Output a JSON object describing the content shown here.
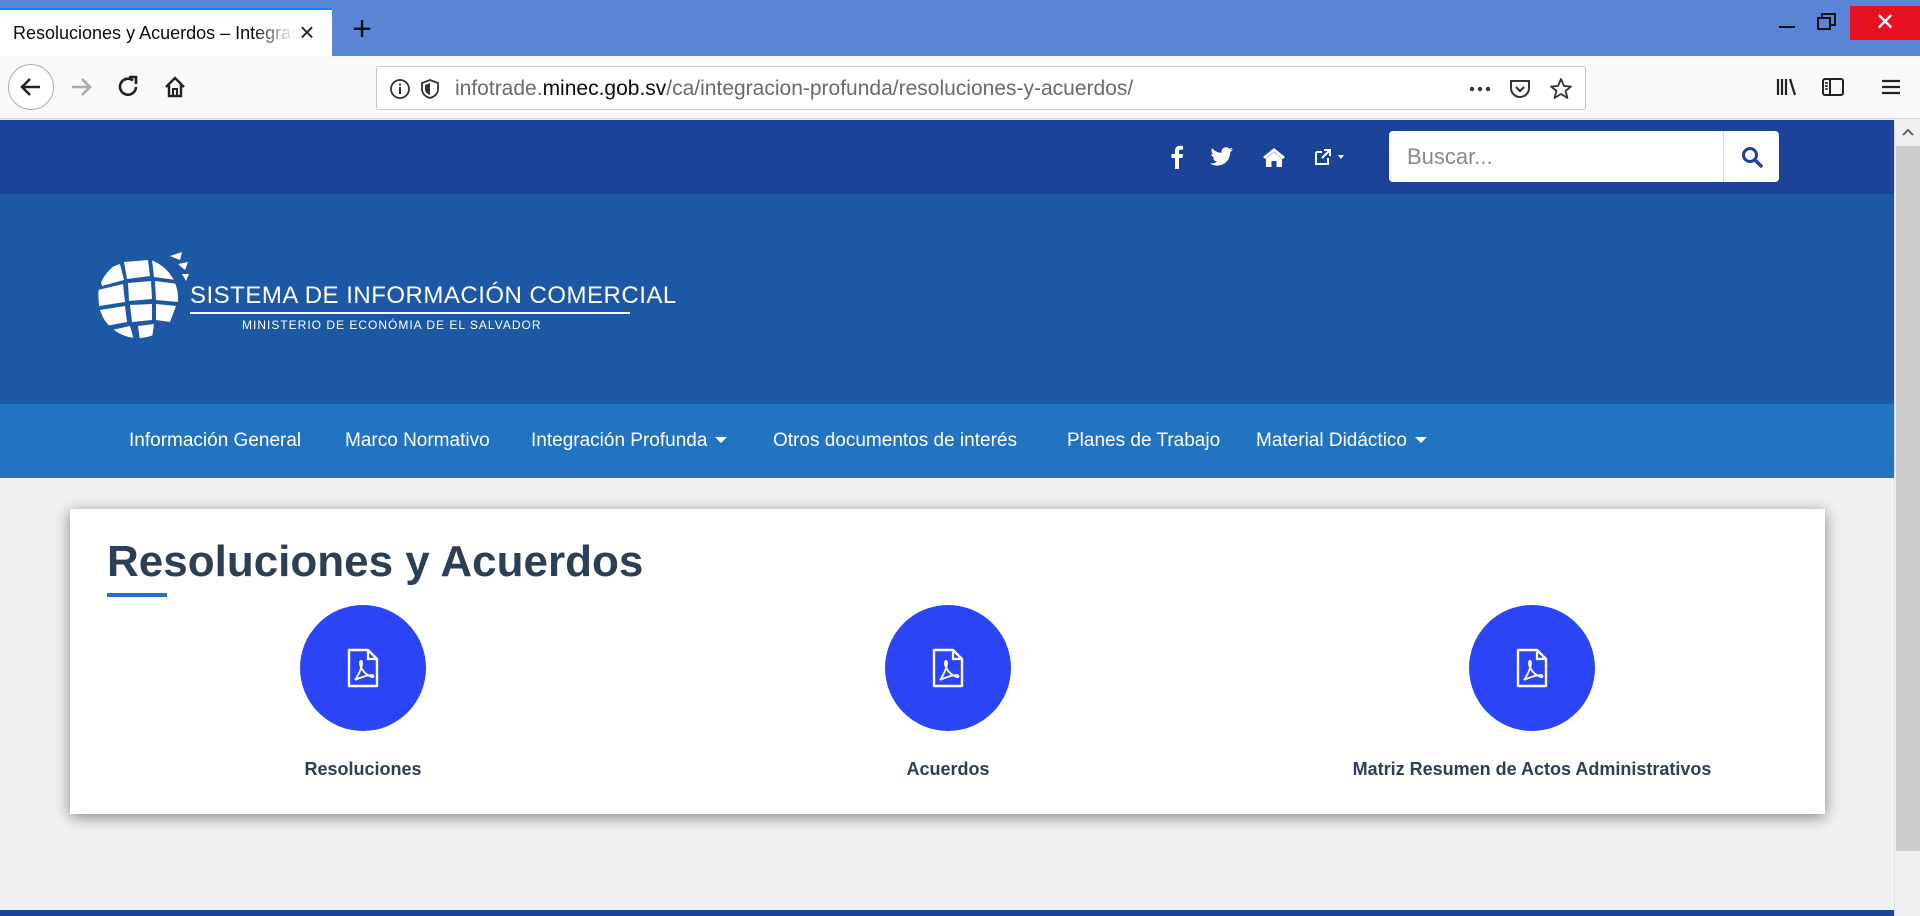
{
  "browser": {
    "tab_title": "Resoluciones y Acuerdos – Integración Profunda",
    "url_prefix": "infotrade.",
    "url_domain": "minec.gob.sv",
    "url_path": "/ca/integracion-profunda/resoluciones-y-acuerdos/"
  },
  "header": {
    "search_placeholder": "Buscar..."
  },
  "logo": {
    "title": "SISTEMA DE INFORMACIÓN COMERCIAL",
    "subtitle": "MINISTERIO DE ECONÓMIA DE EL SALVADOR"
  },
  "menu": [
    {
      "label": "Información General",
      "dropdown": false
    },
    {
      "label": "Marco Normativo",
      "dropdown": false
    },
    {
      "label": "Integración Profunda",
      "dropdown": true
    },
    {
      "label": "Otros documentos de interés",
      "dropdown": false
    },
    {
      "label": "Planes de Trabajo",
      "dropdown": false
    },
    {
      "label": "Material Didáctico",
      "dropdown": true
    }
  ],
  "main": {
    "title": "Resoluciones y Acuerdos",
    "items": [
      {
        "label": "Resoluciones",
        "icon": "pdf-file-icon"
      },
      {
        "label": "Acuerdos",
        "icon": "pdf-file-icon"
      },
      {
        "label": "Matriz Resumen de Actos Administrativos",
        "icon": "pdf-file-icon"
      }
    ]
  },
  "colors": {
    "top_strip": "#1b4399",
    "banner": "#1d58a5",
    "menu_bar": "#2373c3",
    "icon_circle": "#2b44f5",
    "title_text": "#2d3f55"
  }
}
